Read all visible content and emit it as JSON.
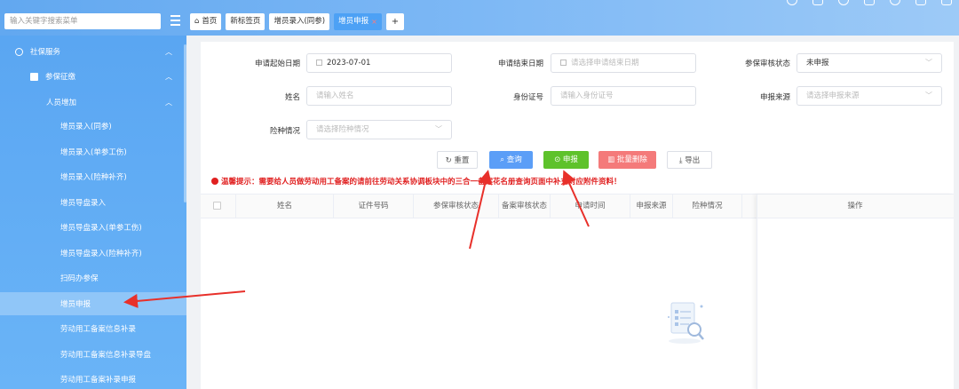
{
  "topbar": {
    "menu_search_placeholder": "输入关键字搜索菜单",
    "tabs": [
      {
        "label": "首页"
      },
      {
        "label": "新标签页"
      },
      {
        "label": "增员录入(同参)"
      },
      {
        "label": "增员申报",
        "close": "×"
      },
      {
        "label": "+"
      }
    ],
    "icons": [
      "search-icon",
      "bell-icon",
      "help-icon",
      "screen-icon",
      "theme-icon",
      "lock-icon",
      "logout-icon"
    ]
  },
  "sidebar": {
    "group": "社保服务",
    "sub": "参保征缴",
    "section": "人员增加",
    "items": [
      {
        "label": "增员录入(同参)"
      },
      {
        "label": "增员录入(单参工伤)"
      },
      {
        "label": "增员录入(险种补齐)"
      },
      {
        "label": "增员导盘录入"
      },
      {
        "label": "增员导盘录入(单参工伤)"
      },
      {
        "label": "增员导盘录入(险种补齐)"
      },
      {
        "label": "扫码办参保"
      },
      {
        "label": "增员申报"
      },
      {
        "label": "劳动用工备案信息补录"
      },
      {
        "label": "劳动用工备案信息补录导盘"
      },
      {
        "label": "劳动用工备案补录申报"
      }
    ],
    "active_index": 7,
    "colors": {
      "bg": "#5aa6f2"
    }
  },
  "filters": {
    "start_date_label": "申请起始日期",
    "start_date_value": "2023-07-01",
    "end_date_label": "申请结束日期",
    "end_date_placeholder": "请选择申请结束日期",
    "audit_label": "参保审核状态",
    "audit_value": "未申报",
    "name_label": "姓名",
    "name_placeholder": "请输入姓名",
    "id_label": "身份证号",
    "id_placeholder": "请输入身份证号",
    "source_label": "申报来源",
    "source_placeholder": "请选择申报来源",
    "insurance_label": "险种情况",
    "insurance_placeholder": "请选择险种情况"
  },
  "buttons": {
    "reset": "重置",
    "query": "查询",
    "declare": "申报",
    "batch_delete": "批量删除",
    "export": "导出"
  },
  "tip": "温馨提示：需要给人员做劳动用工备案的请前往劳动关系协调板块中的三合一备案花名册查询页面中补充对应附件资料！",
  "table": {
    "columns": [
      "姓名",
      "证件号码",
      "参保审核状态",
      "备案审核状态",
      "申请时间",
      "申报来源",
      "险种情况",
      "操作"
    ]
  },
  "colors": {
    "primary": "#5b9ef7",
    "success": "#5ec22b",
    "danger": "#f47a7a",
    "warning_text": "#e02020",
    "annotation_arrow": "#e8302a"
  }
}
